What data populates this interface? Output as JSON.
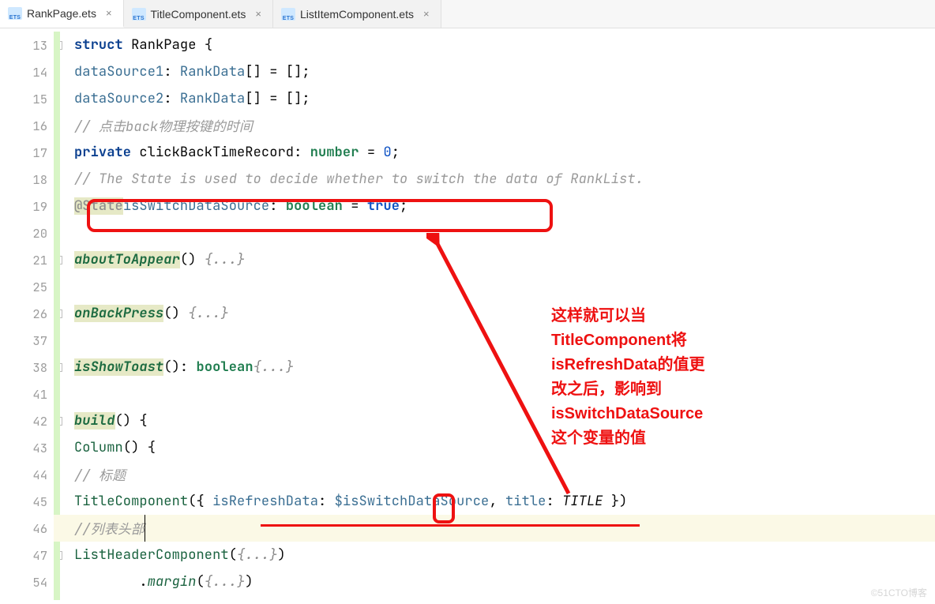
{
  "tabs": [
    {
      "label": "RankPage.ets",
      "active": true
    },
    {
      "label": "TitleComponent.ets",
      "active": false
    },
    {
      "label": "ListItemComponent.ets",
      "active": false
    }
  ],
  "annotation": {
    "l1": "这样就可以当",
    "l2": "TitleComponent将",
    "l3": "isRefreshData的值更",
    "l4": "改之后，影响到",
    "l5": "isSwitchDataSource",
    "l6": "这个变量的值"
  },
  "line_numbers": [
    "13",
    "14",
    "15",
    "16",
    "17",
    "18",
    "19",
    "20",
    "21",
    "25",
    "26",
    "37",
    "38",
    "41",
    "42",
    "43",
    "44",
    "45",
    "46",
    "47",
    "54"
  ],
  "code": {
    "l13_struct": "struct",
    "l13_name": " RankPage ",
    "l13_brace": "{",
    "l14_field": "dataSource1",
    "l14_typekw": "RankData",
    "l14_rest": "[] = [];",
    "l15_field": "dataSource2",
    "l15_typekw": "RankData",
    "l15_rest": "[] = [];",
    "l16_cm": "// 点击back物理按键的时间",
    "l17_kw": "private",
    "l17_name": " clickBackTimeRecord: ",
    "l17_type": "number",
    "l17_eq": " = ",
    "l17_zero": "0",
    "l17_semi": ";",
    "l18_cm": "// The State is used to decide whether to switch the data of RankList.",
    "l19_ann": "@State",
    "l19_name": "isSwitchDataSource",
    "l19_type": "boolean",
    "l19_true": "true",
    "l21_fn": "aboutToAppear",
    "l21_fold": "{...}",
    "l26_fn": "onBackPress",
    "l26_fold": "{...}",
    "l38_fn": "isShowToast",
    "l38_type": "boolean",
    "l38_fold": "{...}",
    "l42_fn": "build",
    "l42_brace": "{",
    "l43_fn": "Column",
    "l43_brace": "{",
    "l44_cm": "// 标题",
    "l45_fn": "TitleComponent",
    "l45_k1": "isRefreshData",
    "l45_v1": "$isSwitchDataSource",
    "l45_k2": "title",
    "l45_v2": "TITLE",
    "l46_cm": "//列表头部",
    "l47_fn": "ListHeaderComponent",
    "l47_fold": "{...}",
    "l54_fn": "margin",
    "l54_fold": "{...}"
  },
  "watermark": "©51CTO博客"
}
